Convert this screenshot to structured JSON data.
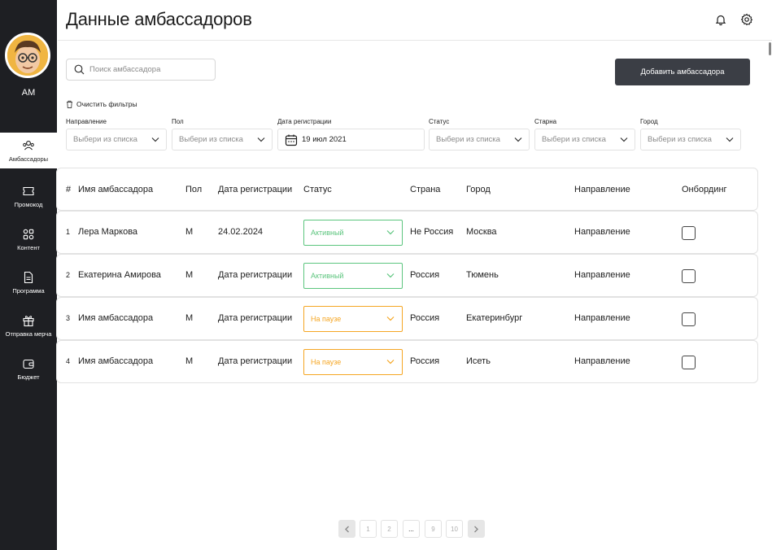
{
  "colors": {
    "sidebar_bg": "#1e1f23",
    "primary_button": "#3b3e45",
    "status_active": "#5cc57e",
    "status_paused": "#f5a623"
  },
  "user": {
    "initials": "АМ"
  },
  "sidebar": {
    "items": [
      {
        "label": "Амбассадоры",
        "icon": "users-icon"
      },
      {
        "label": "Промокод",
        "icon": "ticket-icon"
      },
      {
        "label": "Контент",
        "icon": "content-icon"
      },
      {
        "label": "Программа",
        "icon": "document-icon"
      },
      {
        "label": "Отправка мерча",
        "icon": "gift-icon"
      },
      {
        "label": "Бюджет",
        "icon": "wallet-icon"
      }
    ]
  },
  "header": {
    "title": "Данные амбассадоров"
  },
  "search": {
    "placeholder": "Поиск амбассадора"
  },
  "toolbar": {
    "add_label": "Добавить амбассадора",
    "clear_label": "Очистить фильтры"
  },
  "filters": [
    {
      "label": "Направление",
      "value": "Выбери из списка"
    },
    {
      "label": "Пол",
      "value": "Выбери из списка"
    },
    {
      "label": "Дата регистрации",
      "value": "19 июл 2021"
    },
    {
      "label": "Статус",
      "value": "Выбери из списка"
    },
    {
      "label": "Старна",
      "value": "Выбери из списка"
    },
    {
      "label": "Город",
      "value": "Выбери из списка"
    }
  ],
  "table": {
    "headers": [
      "#",
      "Имя амбассадора",
      "Пол",
      "Дата регистрации",
      "Статус",
      "Страна",
      "Город",
      "Направление",
      "Онбординг"
    ],
    "rows": [
      {
        "num": "1",
        "name": "Лера Маркова",
        "gender": "М",
        "date": "24.02.2024",
        "status": "Активный",
        "country": "Не Россия",
        "city": "Москва",
        "direction": "Направление"
      },
      {
        "num": "2",
        "name": "Екатерина Амирова",
        "gender": "М",
        "date": "Дата регистрации",
        "status": "Активный",
        "country": "Россия",
        "city": "Тюмень",
        "direction": "Направление"
      },
      {
        "num": "3",
        "name": "Имя амбассадора",
        "gender": "М",
        "date": "Дата регистрации",
        "status": "На паузе",
        "country": "Россия",
        "city": "Екатеринбург",
        "direction": "Направление"
      },
      {
        "num": "4",
        "name": "Имя амбассадора",
        "gender": "М",
        "date": "Дата регистрации",
        "status": "На паузе",
        "country": "Россия",
        "city": "Исеть",
        "direction": "Направление"
      }
    ]
  },
  "pagination": {
    "pages": [
      "1",
      "2",
      "...",
      "9",
      "10"
    ]
  }
}
